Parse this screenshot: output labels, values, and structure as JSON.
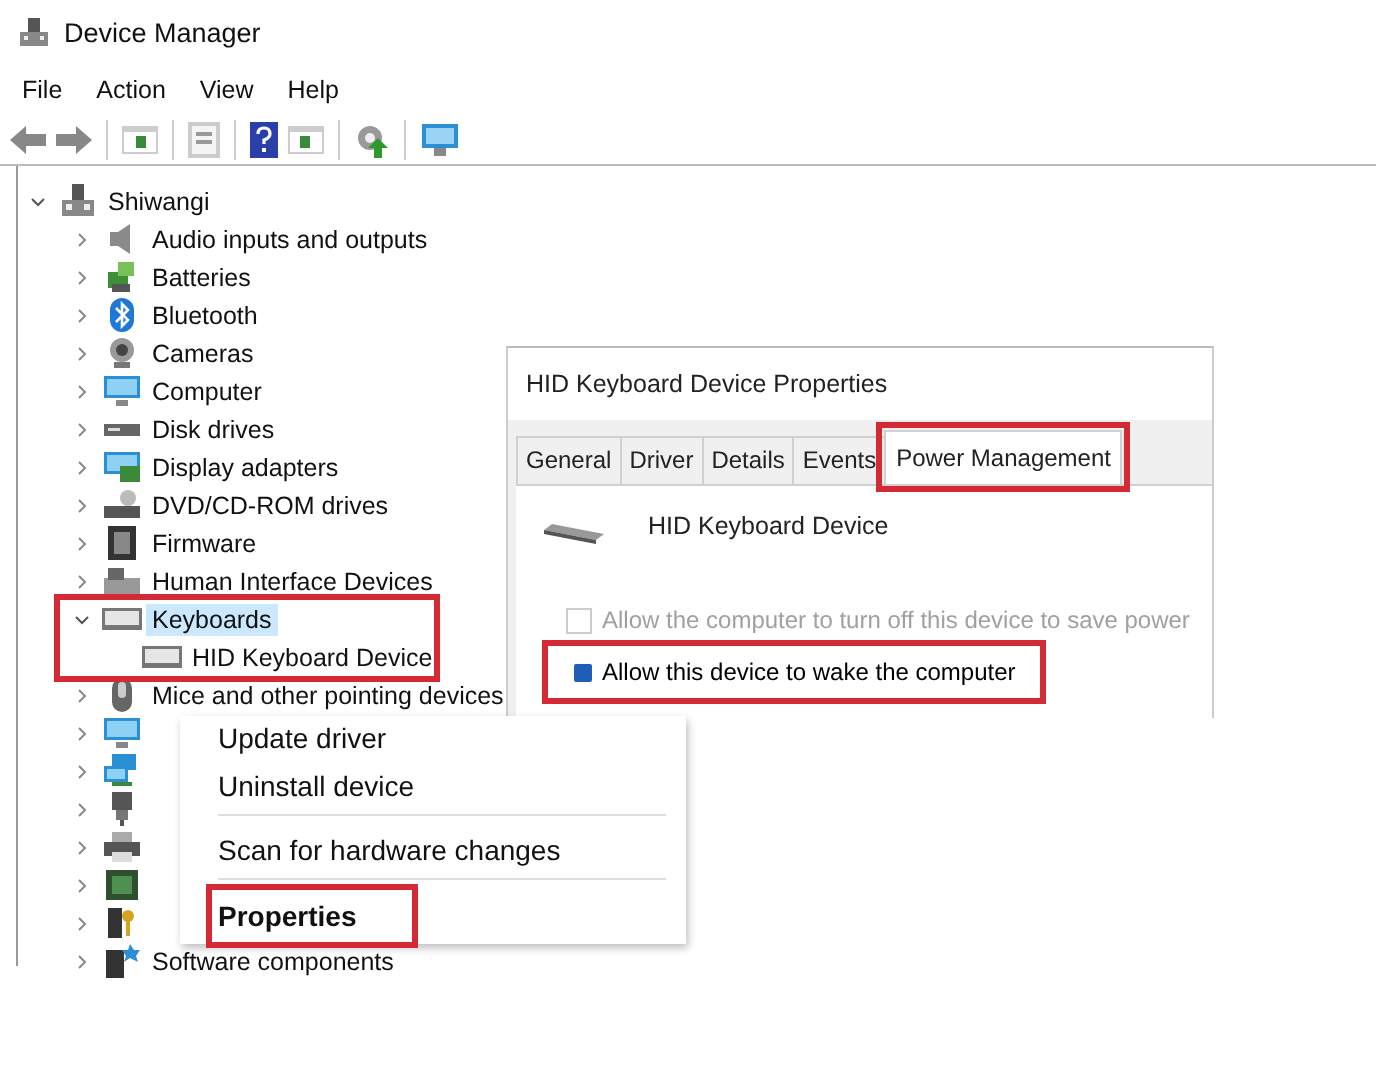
{
  "window": {
    "title": "Device Manager"
  },
  "menu_bar": [
    "File",
    "Action",
    "View",
    "Help"
  ],
  "tree": {
    "label": "Shiwangi",
    "expanded": true,
    "selected": false,
    "children": [
      {
        "label": "Audio inputs and outputs",
        "expanded": false,
        "selected": false
      },
      {
        "label": "Batteries",
        "expanded": false,
        "selected": false
      },
      {
        "label": "Bluetooth",
        "expanded": false,
        "selected": false
      },
      {
        "label": "Cameras",
        "expanded": false,
        "selected": false
      },
      {
        "label": "Computer",
        "expanded": false,
        "selected": false
      },
      {
        "label": "Disk drives",
        "expanded": false,
        "selected": false
      },
      {
        "label": "Display adapters",
        "expanded": false,
        "selected": false
      },
      {
        "label": "DVD/CD-ROM drives",
        "expanded": false,
        "selected": false
      },
      {
        "label": "Firmware",
        "expanded": false,
        "selected": false
      },
      {
        "label": "Human Interface Devices",
        "expanded": false,
        "selected": false
      },
      {
        "label": "Keyboards",
        "expanded": true,
        "selected": true,
        "highlighted": true,
        "children": [
          {
            "label": "HID Keyboard Device",
            "selected": false
          }
        ]
      },
      {
        "label": "Mice and other pointing devices",
        "expanded": false,
        "selected": false
      },
      {
        "expanded": false,
        "selected": false
      },
      {
        "expanded": false,
        "selected": false
      },
      {
        "expanded": false,
        "selected": false
      },
      {
        "expanded": false,
        "selected": false
      },
      {
        "expanded": false,
        "selected": false
      },
      {
        "expanded": false,
        "selected": false
      },
      {
        "label": "Software components",
        "expanded": false,
        "selected": false
      }
    ]
  },
  "dialog": {
    "title": "HID Keyboard Device Properties",
    "tabs": [
      {
        "label": "General",
        "selected": false,
        "highlighted": false
      },
      {
        "label": "Driver",
        "selected": false,
        "highlighted": false
      },
      {
        "label": "Details",
        "selected": false,
        "highlighted": false
      },
      {
        "label": "Events",
        "selected": false,
        "highlighted": false
      },
      {
        "label": "Power Management",
        "selected": true,
        "highlighted": true
      }
    ],
    "device_name": "HID Keyboard Device",
    "options": [
      {
        "label": "Allow the computer to turn off this device to save power",
        "checked": false,
        "disabled": true,
        "highlighted": false
      },
      {
        "label": "Allow this device to wake the computer",
        "checked": true,
        "disabled": false,
        "highlighted": true
      }
    ]
  },
  "context_menu": {
    "items": [
      {
        "label": "Update driver",
        "separator_before": false,
        "default": false,
        "highlighted": false
      },
      {
        "label": "Uninstall device",
        "separator_before": false,
        "default": false,
        "highlighted": false
      },
      {
        "label": "Scan for hardware changes",
        "separator_before": true,
        "default": false,
        "highlighted": false
      },
      {
        "label": "Properties",
        "separator_before": true,
        "default": true,
        "highlighted": true
      }
    ]
  }
}
